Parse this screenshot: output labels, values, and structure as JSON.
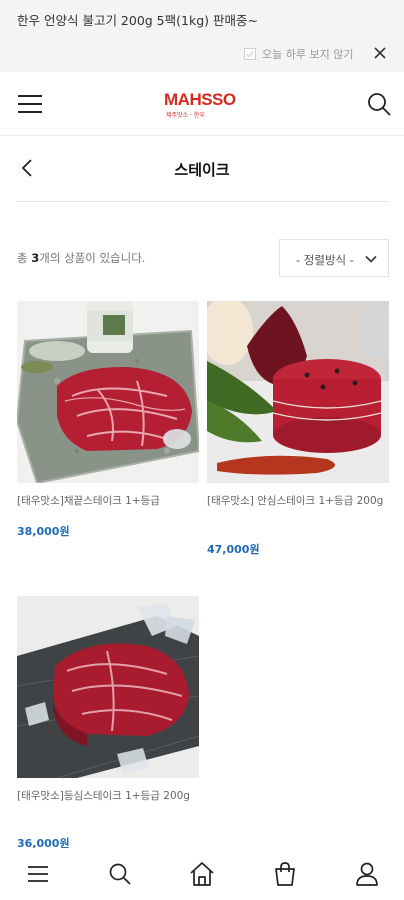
{
  "promo": {
    "text": "한우 언양식 불고기 200g 5팩(1kg) 판매중~",
    "dismiss_label": "오늘 하루 보지 않기",
    "close_icon": "close-icon"
  },
  "header": {
    "logo_main": "MAHSSO",
    "logo_sub": "제주맛소 · 한우",
    "menu_icon": "hamburger-icon",
    "search_icon": "search-icon"
  },
  "page": {
    "title": "스테이크",
    "back_icon": "chevron-left-icon"
  },
  "listing": {
    "count_prefix": "총 ",
    "count": "3",
    "count_suffix": "개의 상품이 있습니다.",
    "sort_label": "- 정렬방식 -"
  },
  "products": [
    {
      "name": "[태우맛소]채끝스테이크 1+등급",
      "price": "38,000원"
    },
    {
      "name": "[태우맛소] 안심스테이크 1+등급 200g",
      "price": "47,000원"
    },
    {
      "name": "[태우맛소]등심스테이크 1+등급 200g",
      "price": "36,000원"
    }
  ],
  "bottom_nav": [
    "menu-icon",
    "search-icon",
    "home-icon",
    "cart-icon",
    "user-icon"
  ],
  "colors": {
    "accent_price": "#1f6bb5",
    "brand": "#d52b1e",
    "promo_bg": "#f4f4f4"
  }
}
